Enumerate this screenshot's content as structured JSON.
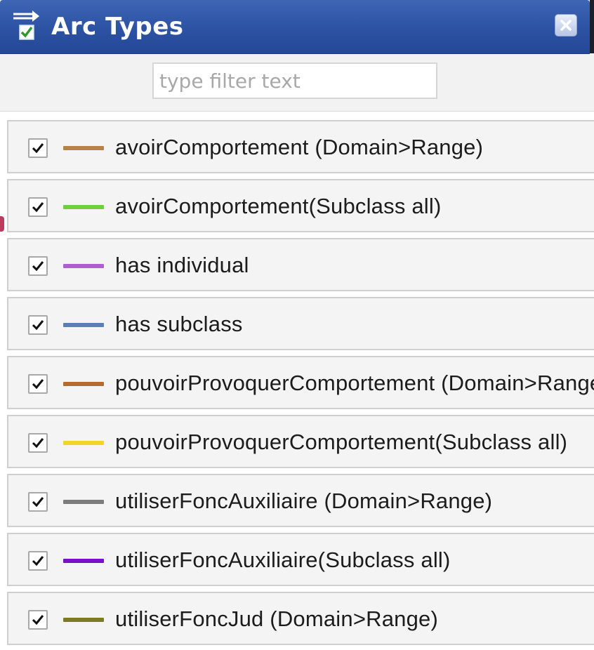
{
  "window": {
    "title": "Arc Types",
    "title_icon": "filter-checklist-icon",
    "close_icon": "close-icon"
  },
  "filter": {
    "placeholder": "type filter text",
    "value": ""
  },
  "arc_types": {
    "items": [
      {
        "label": "avoirComportement (Domain>Range)",
        "color": "#b58445",
        "checked": true
      },
      {
        "label": "avoirComportement(Subclass all)",
        "color": "#6fcf3c",
        "checked": true
      },
      {
        "label": "has individual",
        "color": "#b05fd2",
        "checked": true
      },
      {
        "label": "has subclass",
        "color": "#5c7fb3",
        "checked": true
      },
      {
        "label": "pouvoirProvoquerComportement (Domain>Range)",
        "color": "#b86a2c",
        "checked": true
      },
      {
        "label": "pouvoirProvoquerComportement(Subclass all)",
        "color": "#f0d629",
        "checked": true
      },
      {
        "label": "utiliserFoncAuxiliaire (Domain>Range)",
        "color": "#7c7c7c",
        "checked": true
      },
      {
        "label": "utiliserFoncAuxiliaire(Subclass all)",
        "color": "#7a0fc9",
        "checked": true
      },
      {
        "label": "utiliserFoncJud (Domain>Range)",
        "color": "#7e7a1f",
        "checked": true
      }
    ]
  }
}
